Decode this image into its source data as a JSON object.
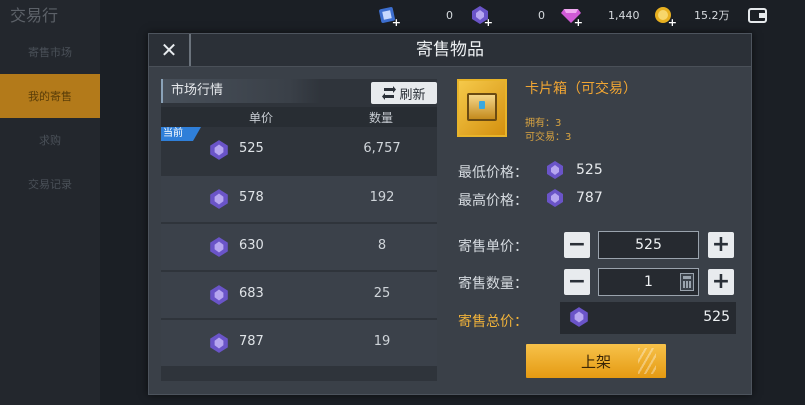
{
  "background": {
    "title": "交易行",
    "sidebar": [
      "寄售市场",
      "我的寄售",
      "求购",
      "交易记录"
    ]
  },
  "topbar": {
    "ticket_count": "0",
    "crystal_count": "0",
    "diamond_count": "1,440",
    "gold_count": "15.2万"
  },
  "dialog": {
    "title": "寄售物品",
    "close_glyph": "✕"
  },
  "market": {
    "label": "市场行情",
    "refresh_label": "刷新",
    "col_price": "单价",
    "col_qty": "数量",
    "current_badge": "当前",
    "rows": [
      {
        "price": "525",
        "qty": "6,757"
      },
      {
        "price": "578",
        "qty": "192"
      },
      {
        "price": "630",
        "qty": "8"
      },
      {
        "price": "683",
        "qty": "25"
      },
      {
        "price": "787",
        "qty": "19"
      }
    ]
  },
  "item": {
    "name": "卡片箱（可交易）",
    "owned": "拥有：3",
    "tradable": "可交易：3"
  },
  "info": {
    "min_label": "最低价格：",
    "min_value": "525",
    "max_label": "最高价格：",
    "max_value": "787"
  },
  "form": {
    "price_label": "寄售单价：",
    "price_value": "525",
    "qty_label": "寄售数量：",
    "qty_value": "1",
    "total_label": "寄售总价：",
    "total_value": "525",
    "minus": "−",
    "plus": "+",
    "submit_label": "上架"
  },
  "colors": {
    "accent_orange": "#f0a533",
    "badge_blue": "#2f7fd9",
    "gem_purple": "#7b5cd6"
  }
}
